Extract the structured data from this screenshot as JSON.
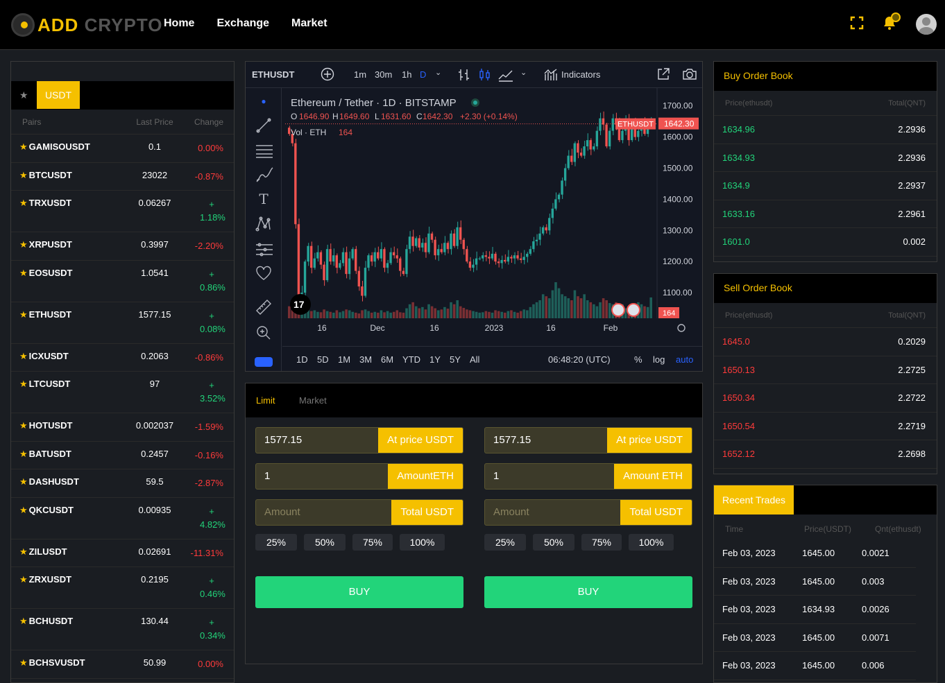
{
  "brand": {
    "word1": "ADD",
    "word2": "CRYPTO"
  },
  "nav": [
    "Home",
    "Exchange",
    "Market"
  ],
  "pairs_panel": {
    "tab_active": "USDT",
    "columns": [
      "Pairs",
      "Last Price",
      "Change"
    ],
    "rows": [
      {
        "pair": "GAMISOUSDT",
        "price": "0.1",
        "change": "0.00%",
        "dir": "neg"
      },
      {
        "pair": "BTCUSDT",
        "price": "23022",
        "change": "-0.87%",
        "dir": "neg"
      },
      {
        "pair": "TRXUSDT",
        "price": "0.06267",
        "change": "+ 1.18%",
        "dir": "pos"
      },
      {
        "pair": "XRPUSDT",
        "price": "0.3997",
        "change": "-2.20%",
        "dir": "neg"
      },
      {
        "pair": "EOSUSDT",
        "price": "1.0541",
        "change": "+ 0.86%",
        "dir": "pos"
      },
      {
        "pair": "ETHUSDT",
        "price": "1577.15",
        "change": "+ 0.08%",
        "dir": "pos"
      },
      {
        "pair": "ICXUSDT",
        "price": "0.2063",
        "change": "-0.86%",
        "dir": "neg"
      },
      {
        "pair": "LTCUSDT",
        "price": "97",
        "change": "+ 3.52%",
        "dir": "pos"
      },
      {
        "pair": "HOTUSDT",
        "price": "0.002037",
        "change": "-1.59%",
        "dir": "neg"
      },
      {
        "pair": "BATUSDT",
        "price": "0.2457",
        "change": "-0.16%",
        "dir": "neg"
      },
      {
        "pair": "DASHUSDT",
        "price": "59.5",
        "change": "-2.87%",
        "dir": "neg"
      },
      {
        "pair": "QKCUSDT",
        "price": "0.00935",
        "change": "+ 4.82%",
        "dir": "pos"
      },
      {
        "pair": "ZILUSDT",
        "price": "0.02691",
        "change": "-11.31%",
        "dir": "neg"
      },
      {
        "pair": "ZRXUSDT",
        "price": "0.2195",
        "change": "+ 0.46%",
        "dir": "pos"
      },
      {
        "pair": "BCHUSDT",
        "price": "130.44",
        "change": "+ 0.34%",
        "dir": "pos"
      },
      {
        "pair": "BCHSVUSDT",
        "price": "50.99",
        "change": "0.00%",
        "dir": "neg"
      }
    ]
  },
  "chart_toolbar": {
    "symbol": "ETHUSDT",
    "intervals": [
      "1m",
      "30m",
      "1h",
      "D"
    ],
    "indicators": "Indicators"
  },
  "chart_legend": {
    "title": "Ethereum / Tether · 1D · BITSTAMP",
    "o_label": "O",
    "o": "1646.90",
    "h_label": "H",
    "h": "1649.60",
    "l_label": "L",
    "l": "1631.60",
    "c_label": "C",
    "c": "1642.30",
    "chg": "+2.30 (+0.14%)",
    "vol_label": "Vol · ETH",
    "vol": "164"
  },
  "chart_bottom": {
    "ranges": [
      "1D",
      "5D",
      "1M",
      "3M",
      "6M",
      "YTD",
      "1Y",
      "5Y",
      "All"
    ],
    "time": "06:48:20 (UTC)",
    "pct": "%",
    "log": "log",
    "auto": "auto"
  },
  "chart_data": {
    "type": "candlestick",
    "symbol_tag": "ETHUSDT",
    "last_price": "1642.30",
    "last_volume": "164",
    "y_ticks": [
      "1700.00",
      "1600.00",
      "1500.00",
      "1400.00",
      "1300.00",
      "1200.00",
      "1100.00"
    ],
    "y_tick_values": [
      1700,
      1600,
      1500,
      1400,
      1300,
      1200,
      1100
    ],
    "x_ticks": [
      "16",
      "Dec",
      "16",
      "2023",
      "16",
      "Feb"
    ],
    "ylim": [
      1040,
      1735
    ],
    "closes": [
      1610,
      1580,
      1320,
      1080,
      1100,
      1200,
      1250,
      1180,
      1210,
      1230,
      1190,
      1140,
      1240,
      1200,
      1220,
      1180,
      1195,
      1230,
      1160,
      1210,
      1240,
      1170,
      1120,
      1090,
      1180,
      1220,
      1200,
      1230,
      1210,
      1240,
      1180,
      1195,
      1230,
      1220,
      1210,
      1170,
      1160,
      1240,
      1280,
      1250,
      1275,
      1245,
      1260,
      1230,
      1290,
      1270,
      1220,
      1240,
      1230,
      1260,
      1240,
      1290,
      1250,
      1310,
      1270,
      1240,
      1200,
      1180,
      1190,
      1210,
      1210,
      1220,
      1215,
      1210,
      1225,
      1200,
      1195,
      1205,
      1200,
      1215,
      1210,
      1220,
      1210,
      1205,
      1215,
      1225,
      1240,
      1265,
      1270,
      1290,
      1310,
      1300,
      1340,
      1370,
      1400,
      1415,
      1460,
      1500,
      1540,
      1520,
      1580,
      1550,
      1540,
      1570,
      1590,
      1560,
      1570,
      1620,
      1660,
      1640,
      1570,
      1620,
      1660,
      1640,
      1590,
      1620,
      1660,
      1590,
      1640,
      1600,
      1620,
      1650,
      1610,
      1640,
      1642
    ],
    "volumes": [
      30,
      20,
      55,
      40,
      35,
      25,
      20,
      18,
      20,
      16,
      15,
      22,
      18,
      16,
      14,
      20,
      15,
      18,
      22,
      20,
      16,
      14,
      12,
      20,
      22,
      18,
      14,
      16,
      14,
      20,
      15,
      18,
      14,
      16,
      20,
      15,
      14,
      25,
      35,
      40,
      30,
      25,
      28,
      22,
      35,
      30,
      25,
      20,
      22,
      28,
      24,
      40,
      35,
      45,
      30,
      26,
      22,
      20,
      18,
      16,
      14,
      15,
      18,
      16,
      14,
      20,
      18,
      16,
      14,
      18,
      20,
      16,
      14,
      18,
      22,
      20,
      28,
      35,
      40,
      45,
      60,
      55,
      50,
      70,
      90,
      75,
      60,
      55,
      50,
      45,
      70,
      55,
      50,
      60,
      45,
      40,
      35,
      30,
      40,
      50,
      45,
      38,
      35,
      40,
      30,
      35,
      25,
      20,
      28,
      30,
      40,
      35,
      30,
      28,
      52
    ],
    "title": "Ethereum / Tether · 1D · BITSTAMP",
    "xlabel": "",
    "ylabel": ""
  },
  "trade_form": {
    "tabs": [
      "Limit",
      "Market"
    ],
    "left": {
      "price_value": "1577.15",
      "price_label": "At price USDT",
      "amount_value": "1",
      "amount_label": "AmountETH",
      "total_placeholder": "Amount",
      "total_label": "Total USDT",
      "button": "BUY"
    },
    "right": {
      "price_value": "1577.15",
      "price_label": "At price USDT",
      "amount_value": "1",
      "amount_label": "Amount ETH",
      "total_placeholder": "Amount",
      "total_label": "Total USDT",
      "button": "BUY"
    },
    "percents": [
      "25%",
      "50%",
      "75%",
      "100%"
    ]
  },
  "buy_book": {
    "title": "Buy Order Book",
    "columns": [
      "Price(ethusdt)",
      "Total(QNT)"
    ],
    "rows": [
      {
        "price": "1634.96",
        "total": "2.2936"
      },
      {
        "price": "1634.93",
        "total": "2.2936"
      },
      {
        "price": "1634.9",
        "total": "2.2937"
      },
      {
        "price": "1633.16",
        "total": "2.2961"
      },
      {
        "price": "1601.0",
        "total": "0.002"
      }
    ]
  },
  "sell_book": {
    "title": "Sell Order Book",
    "columns": [
      "Price(ethusdt)",
      "Total(QNT)"
    ],
    "rows": [
      {
        "price": "1645.0",
        "total": "0.2029"
      },
      {
        "price": "1650.13",
        "total": "2.2725"
      },
      {
        "price": "1650.34",
        "total": "2.2722"
      },
      {
        "price": "1650.54",
        "total": "2.2719"
      },
      {
        "price": "1652.12",
        "total": "2.2698"
      }
    ]
  },
  "recent_trades": {
    "title": "Recent Trades",
    "columns": [
      "Time",
      "Price(USDT)",
      "Qnt(ethusdt)"
    ],
    "rows": [
      {
        "time": "Feb 03, 2023",
        "price": "1645.00",
        "qty": "0.0021"
      },
      {
        "time": "Feb 03, 2023",
        "price": "1645.00",
        "qty": "0.003"
      },
      {
        "time": "Feb 03, 2023",
        "price": "1634.93",
        "qty": "0.0026"
      },
      {
        "time": "Feb 03, 2023",
        "price": "1645.00",
        "qty": "0.0071"
      },
      {
        "time": "Feb 03, 2023",
        "price": "1645.00",
        "qty": "0.006"
      }
    ]
  },
  "colors": {
    "accent": "#f5c000",
    "up": "#26a69a",
    "down": "#ef5350",
    "buy": "#22d47a",
    "sell": "#ff3b3b"
  }
}
